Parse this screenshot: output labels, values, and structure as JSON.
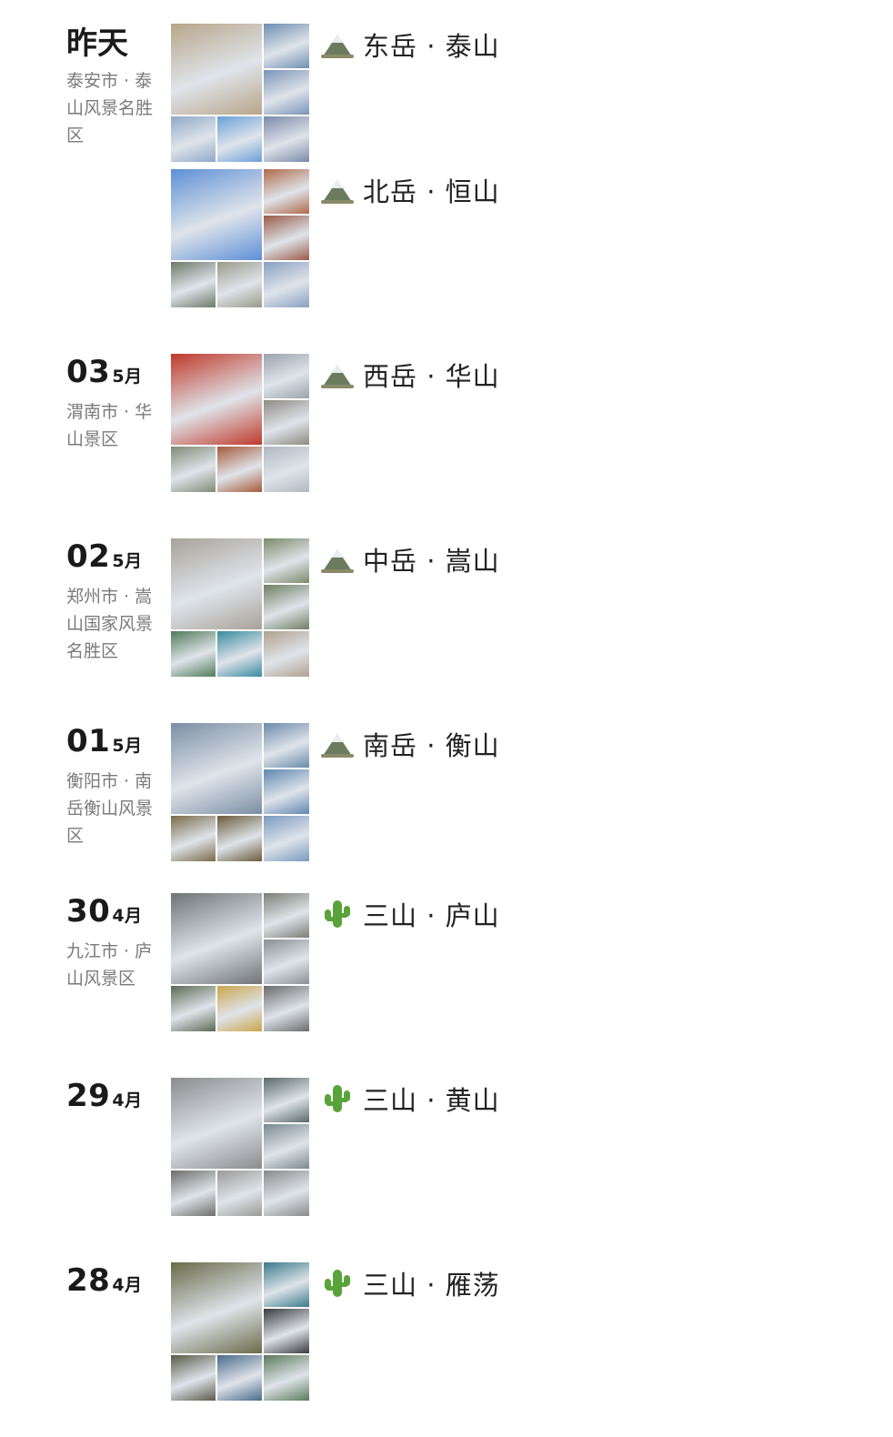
{
  "entries": [
    {
      "date_day": "昨天",
      "date_month": "",
      "location": "泰安市 · 泰山风景名胜区",
      "posts": [
        {
          "caption": "东岳 · 泰山",
          "icon": "mountain-icon",
          "tiles": [
            "#b8a58a",
            "#6f8fb0",
            "#7a94b8",
            "#8fa9c9",
            "#6aa0d8",
            "#7a8aa8"
          ]
        },
        {
          "caption": "北岳 · 恒山",
          "icon": "mountain-icon",
          "tiles": [
            "#5d8fd6",
            "#b06a4a",
            "#9a5a48",
            "#6b7a6a",
            "#9a9a8a",
            "#8aa0c0"
          ]
        }
      ]
    },
    {
      "date_day": "03",
      "date_month": "5月",
      "location": "渭南市 · 华山景区",
      "posts": [
        {
          "caption": "西岳 · 华山",
          "icon": "mountain-icon",
          "tiles": [
            "#c0392b",
            "#9aa3ad",
            "#8e8a82",
            "#7f8c78",
            "#a55a3a",
            "#b0b8c0"
          ]
        }
      ]
    },
    {
      "date_day": "02",
      "date_month": "5月",
      "location": "郑州市 · 嵩山国家风景名胜区",
      "posts": [
        {
          "caption": "中岳 · 嵩山",
          "icon": "mountain-icon",
          "tiles": [
            "#a8a29a",
            "#7d8a6a",
            "#6e7e62",
            "#4f7a5a",
            "#3a8aa0",
            "#b0a090"
          ]
        }
      ]
    },
    {
      "date_day": "01",
      "date_month": "5月",
      "location": "衡阳市 · 南岳衡山风景区",
      "posts": [
        {
          "caption": "南岳 · 衡山",
          "icon": "mountain-icon",
          "tiles": [
            "#7b8ea5",
            "#6a8aa8",
            "#5f86b0",
            "#7a6a4a",
            "#6a5a3a",
            "#7a9ac0"
          ]
        }
      ]
    },
    {
      "date_day": "30",
      "date_month": "4月",
      "location": "九江市 · 庐山风景区",
      "posts": [
        {
          "caption": "三山 · 庐山",
          "icon": "cactus-icon",
          "tiles": [
            "#6f7377",
            "#7a7f75",
            "#8a9096",
            "#5a6a55",
            "#c9a64a",
            "#6a6a6a"
          ]
        }
      ]
    },
    {
      "date_day": "29",
      "date_month": "4月",
      "location": "",
      "posts": [
        {
          "caption": "三山 · 黄山",
          "icon": "cactus-icon",
          "tiles": [
            "#8a8c8e",
            "#5a6a6a",
            "#7a8a90",
            "#6e6e6a",
            "#9a9a96",
            "#8a8a8a"
          ]
        }
      ]
    },
    {
      "date_day": "28",
      "date_month": "4月",
      "location": "",
      "posts": [
        {
          "caption": "三山 · 雁荡",
          "icon": "cactus-icon",
          "tiles": [
            "#6a6a4a",
            "#3a7a8a",
            "#3a3a40",
            "#5a5a4a",
            "#4a6a8a",
            "#5a7a5a"
          ]
        }
      ]
    }
  ]
}
